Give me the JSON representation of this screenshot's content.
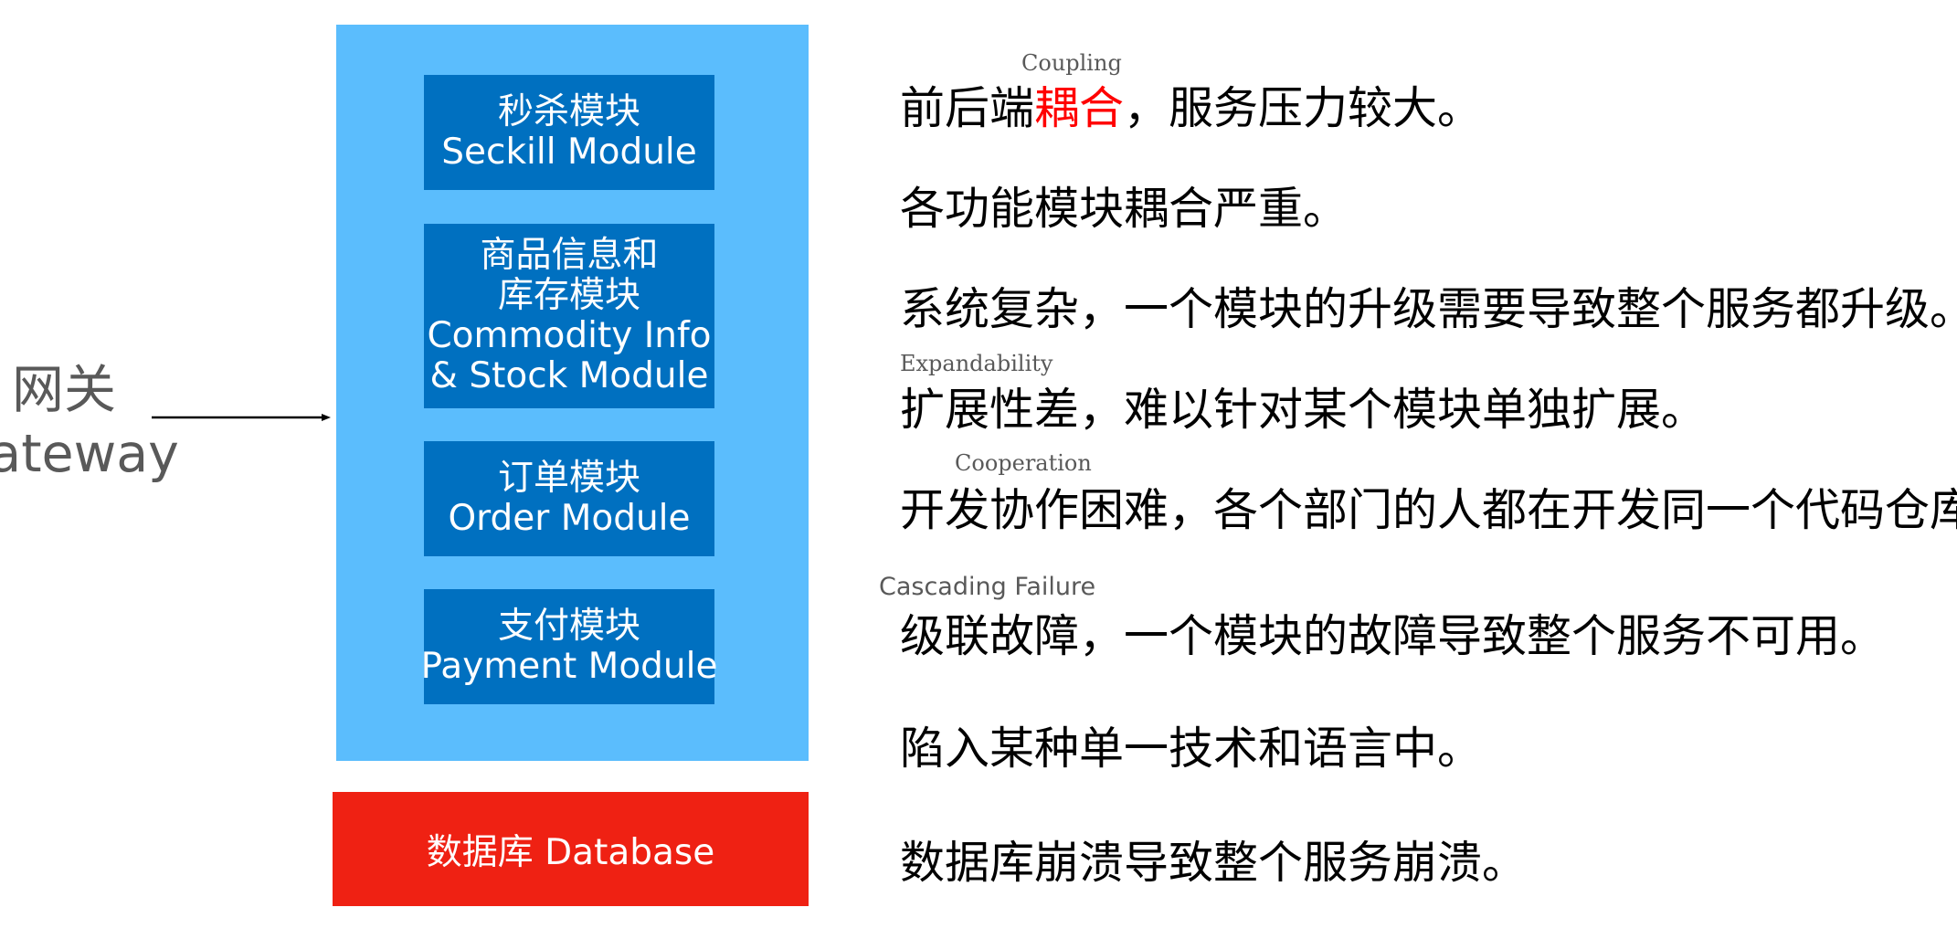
{
  "gateway": {
    "label_cn": "网关",
    "label_en": "Gateway"
  },
  "modules": [
    {
      "lines": [
        "秒杀模块",
        "Seckill Module"
      ]
    },
    {
      "lines": [
        "商品信息和",
        "库存模块",
        "Commodity Info",
        "& Stock Module"
      ]
    },
    {
      "lines": [
        "订单模块",
        "Order Module"
      ]
    },
    {
      "lines": [
        "支付模块",
        "Payment Module"
      ]
    }
  ],
  "database": {
    "label": "数据库 Database"
  },
  "issues": [
    {
      "before": "前后端",
      "highlight": "耦合",
      "after": "，服务压力较大。"
    },
    {
      "text": "各功能模块耦合严重。"
    },
    {
      "text": "系统复杂，一个模块的升级需要导致整个服务都升级。"
    },
    {
      "text": "扩展性差，难以针对某个模块单独扩展。"
    },
    {
      "text": "开发协作困难，各个部门的人都在开发同一个代码仓库。"
    },
    {
      "text": "级联故障，一个模块的故障导致整个服务不可用。"
    },
    {
      "text": "陷入某种单一技术和语言中。"
    },
    {
      "text": "数据库崩溃导致整个服务崩溃。"
    }
  ],
  "annotations": {
    "coupling": "Coupling",
    "expandability": "Expandability",
    "cooperation": "Cooperation",
    "cascading_failure": "Cascading Failure"
  },
  "colors": {
    "module_container": "#5bbdfd",
    "module_box": "#0070c0",
    "database": "#ef2113",
    "highlight": "#ff0000"
  }
}
